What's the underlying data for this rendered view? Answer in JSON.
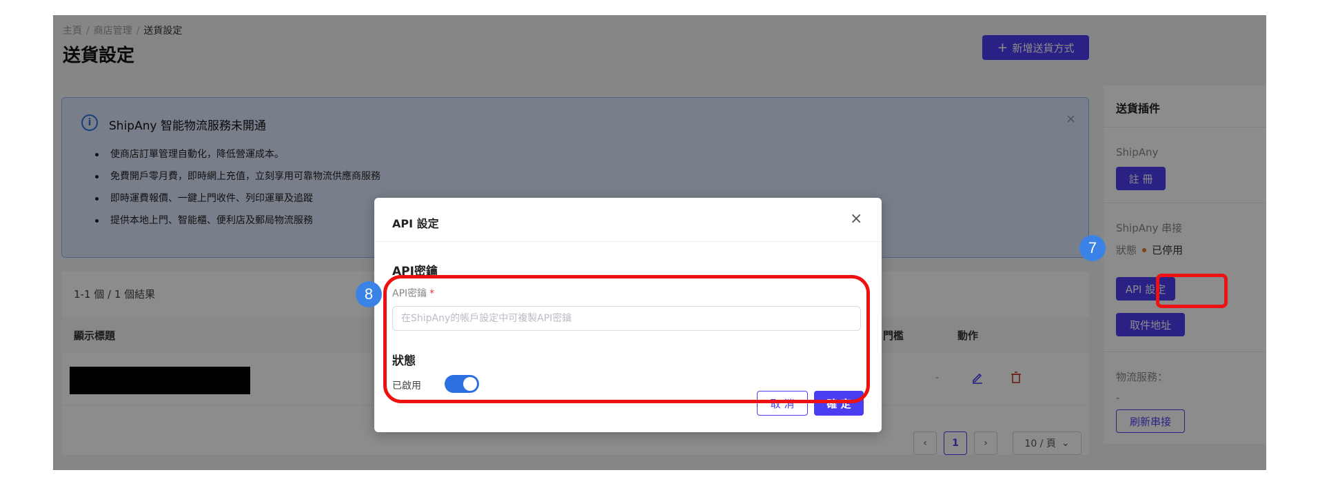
{
  "breadcrumb": {
    "home": "主頁",
    "store": "商店管理",
    "current": "送貨設定"
  },
  "page": {
    "title": "送貨設定",
    "add_button": "新增送貨方式"
  },
  "info": {
    "title": "ShipAny 智能物流服務未開通",
    "items": [
      "使商店訂單管理自動化，降低營運成本。",
      "免費開戶零月費，即時網上充值，立刻享用可靠物流供應商服務",
      "即時運費報價、一鍵上門收件、列印運單及追蹤",
      "提供本地上門、智能櫃、便利店及郵局物流服務"
    ]
  },
  "table": {
    "result_count": "1-1 個 / 1 個結果",
    "columns": {
      "title": "顯示標題",
      "threshold": "門檻",
      "action": "動作"
    },
    "rows": [
      {
        "threshold": "-"
      }
    ],
    "pagination": {
      "current_page": "1",
      "page_size": "10 / 頁"
    }
  },
  "sidebar": {
    "title": "送貨插件",
    "shipany_label": "ShipAny",
    "register_button": "註 冊",
    "connect_label": "ShipAny 串接",
    "status_label": "狀態",
    "status_value": "已停用",
    "api_button": "API 設定",
    "pickup_button": "取件地址",
    "logistics_label": "物流服務：",
    "logistics_value": "-",
    "refresh_button": "刷新串接"
  },
  "modal": {
    "title": "API 設定",
    "section_api": "API密鑰",
    "field_label": "API密鑰",
    "required_mark": "*",
    "input_placeholder": "在ShipAny的帳戶設定中可複製API密鑰",
    "input_value": "",
    "section_status": "狀態",
    "toggle_label": "已啟用",
    "toggle_on": true,
    "cancel_button": "取 消",
    "ok_button": "確 定"
  },
  "annotations": {
    "badge_api": "7",
    "badge_modal": "8"
  },
  "colors": {
    "primary": "#4b3df0",
    "highlight": "#ee1111",
    "badge": "#3b82e6",
    "toggle": "#2d6fe0"
  }
}
